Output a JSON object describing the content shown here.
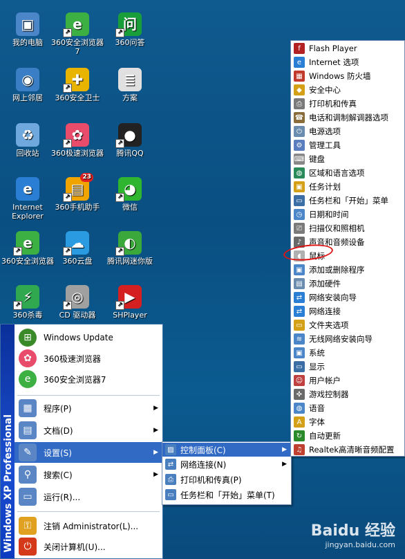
{
  "desktop_icons": [
    {
      "name": "我的电脑",
      "shortcut": false,
      "icon": "computer-icon",
      "color": "#4a86c8"
    },
    {
      "name": "360安全浏览器7",
      "shortcut": true,
      "icon": "browser-360-icon",
      "color": "#3cb043"
    },
    {
      "name": "360问答",
      "shortcut": true,
      "icon": "qa-360-icon",
      "color": "#1a9e3a"
    },
    {
      "name": "网上邻居",
      "shortcut": false,
      "icon": "network-places-icon",
      "color": "#3a7fc6"
    },
    {
      "name": "360安全卫士",
      "shortcut": true,
      "icon": "guard-360-icon",
      "color": "#e8b400"
    },
    {
      "name": "方案",
      "shortcut": false,
      "icon": "document-icon",
      "color": "#e0e0e0"
    },
    {
      "name": "回收站",
      "shortcut": false,
      "icon": "recycle-bin-icon",
      "color": "#6fa8dc"
    },
    {
      "name": "360极速浏览器",
      "shortcut": true,
      "icon": "chrome-360-icon",
      "color": "#e94b6a"
    },
    {
      "name": "腾讯QQ",
      "shortcut": true,
      "icon": "qq-penguin-icon",
      "color": "#222222"
    },
    {
      "name": "Internet Explorer",
      "shortcut": false,
      "icon": "ie-icon",
      "color": "#2a7fd4"
    },
    {
      "name": "360手机助手",
      "shortcut": true,
      "icon": "phone-assistant-icon",
      "color": "#f0a400",
      "badge": "23"
    },
    {
      "name": "微信",
      "shortcut": true,
      "icon": "wechat-icon",
      "color": "#2fb52f"
    },
    {
      "name": "360安全浏览器",
      "shortcut": true,
      "icon": "browser-360-icon",
      "color": "#3cb043"
    },
    {
      "name": "360云盘",
      "shortcut": true,
      "icon": "cloud-disk-icon",
      "color": "#2a9be0"
    },
    {
      "name": "腾讯网迷你版",
      "shortcut": true,
      "icon": "tencent-mini-icon",
      "color": "#3aa83a"
    },
    {
      "name": "360杀毒",
      "shortcut": true,
      "icon": "antivirus-360-icon",
      "color": "#2fa84f"
    },
    {
      "name": "CD 驱动器",
      "shortcut": true,
      "icon": "cd-drive-icon",
      "color": "#a0a0a0"
    },
    {
      "name": "SHPlayer",
      "shortcut": true,
      "icon": "play-icon",
      "color": "#d42020"
    }
  ],
  "start_menu": {
    "band_text": "Windows XP  Professional",
    "pinned": [
      {
        "label": "Windows Update",
        "icon": "windows-logo-icon",
        "color": "#3a8a2a"
      },
      {
        "label": "360极速浏览器",
        "icon": "chrome-360-icon",
        "color": "#e94b6a"
      },
      {
        "label": "360安全浏览器7",
        "icon": "browser-360-icon",
        "color": "#3cb043"
      }
    ],
    "items": [
      {
        "label": "程序(P)",
        "icon": "programs-icon",
        "has_sub": true,
        "highlight": false
      },
      {
        "label": "文档(D)",
        "icon": "documents-icon",
        "has_sub": true,
        "highlight": false
      },
      {
        "label": "设置(S)",
        "icon": "settings-icon",
        "has_sub": true,
        "highlight": true
      },
      {
        "label": "搜索(C)",
        "icon": "search-icon",
        "has_sub": true,
        "highlight": false
      },
      {
        "label": "运行(R)...",
        "icon": "run-icon",
        "has_sub": false,
        "highlight": false
      }
    ],
    "footer": [
      {
        "label": "注销 Administrator(L)...",
        "icon": "logoff-icon"
      },
      {
        "label": "关闭计算机(U)...",
        "icon": "shutdown-icon"
      }
    ]
  },
  "settings_submenu": [
    {
      "label": "控制面板(C)",
      "icon": "control-panel-icon",
      "has_sub": true,
      "highlight": true
    },
    {
      "label": "网络连接(N)",
      "icon": "network-connections-icon",
      "has_sub": true,
      "highlight": false
    },
    {
      "label": "打印机和传真(P)",
      "icon": "printer-icon",
      "has_sub": false,
      "highlight": false
    },
    {
      "label": "任务栏和「开始」菜单(T)",
      "icon": "taskbar-icon",
      "has_sub": false,
      "highlight": false
    }
  ],
  "control_panel_items": [
    {
      "label": "Flash Player",
      "icon": "flash-icon",
      "color": "#b22222"
    },
    {
      "label": "Internet 选项",
      "icon": "ie-options-icon",
      "color": "#2a7fd4"
    },
    {
      "label": "Windows 防火墙",
      "icon": "firewall-icon",
      "color": "#c0392b"
    },
    {
      "label": "安全中心",
      "icon": "shield-icon",
      "color": "#d4a017"
    },
    {
      "label": "打印机和传真",
      "icon": "printer-icon",
      "color": "#7a7a7a"
    },
    {
      "label": "电话和调制解调器选项",
      "icon": "phone-modem-icon",
      "color": "#8a6d3b"
    },
    {
      "label": "电源选项",
      "icon": "power-icon",
      "color": "#6a8caf"
    },
    {
      "label": "管理工具",
      "icon": "admin-tools-icon",
      "color": "#5a7dbf"
    },
    {
      "label": "键盘",
      "icon": "keyboard-icon",
      "color": "#888888"
    },
    {
      "label": "区域和语言选项",
      "icon": "globe-icon",
      "color": "#2a8a5a"
    },
    {
      "label": "任务计划",
      "icon": "scheduled-tasks-icon",
      "color": "#d4a017"
    },
    {
      "label": "任务栏和「开始」菜单",
      "icon": "taskbar-icon",
      "color": "#3a6ea5"
    },
    {
      "label": "日期和时间",
      "icon": "clock-icon",
      "color": "#4a86c8"
    },
    {
      "label": "扫描仪和照相机",
      "icon": "scanner-icon",
      "color": "#7a7a7a"
    },
    {
      "label": "声音和音频设备",
      "icon": "speaker-icon",
      "color": "#6a6a6a"
    },
    {
      "label": "鼠标",
      "icon": "mouse-icon",
      "color": "#b0b0b0"
    },
    {
      "label": "添加或删除程序",
      "icon": "add-remove-icon",
      "color": "#4a86c8"
    },
    {
      "label": "添加硬件",
      "icon": "add-hardware-icon",
      "color": "#6a8caf"
    },
    {
      "label": "网络安装向导",
      "icon": "network-wizard-icon",
      "color": "#2a7fd4"
    },
    {
      "label": "网络连接",
      "icon": "network-connections-icon",
      "color": "#2a7fd4"
    },
    {
      "label": "文件夹选项",
      "icon": "folder-options-icon",
      "color": "#d4a017"
    },
    {
      "label": "无线网络安装向导",
      "icon": "wireless-icon",
      "color": "#4a86c8"
    },
    {
      "label": "系统",
      "icon": "system-icon",
      "color": "#4a86c8"
    },
    {
      "label": "显示",
      "icon": "display-icon",
      "color": "#3a6ea5"
    },
    {
      "label": "用户帐户",
      "icon": "user-accounts-icon",
      "color": "#c04040"
    },
    {
      "label": "游戏控制器",
      "icon": "game-controller-icon",
      "color": "#6a6a6a"
    },
    {
      "label": "语音",
      "icon": "speech-icon",
      "color": "#4a86c8"
    },
    {
      "label": "字体",
      "icon": "fonts-icon",
      "color": "#d4a017"
    },
    {
      "label": "自动更新",
      "icon": "auto-update-icon",
      "color": "#2a8a2a"
    },
    {
      "label": "Realtek高清晰音频配置",
      "icon": "realtek-icon",
      "color": "#c04030"
    }
  ],
  "watermark": {
    "logo": "Baidu 经验",
    "url": "jingyan.baidu.com"
  },
  "colors": {
    "highlight": "#316ac5",
    "desktop": "#0b5b90",
    "annotation": "#e01414"
  }
}
